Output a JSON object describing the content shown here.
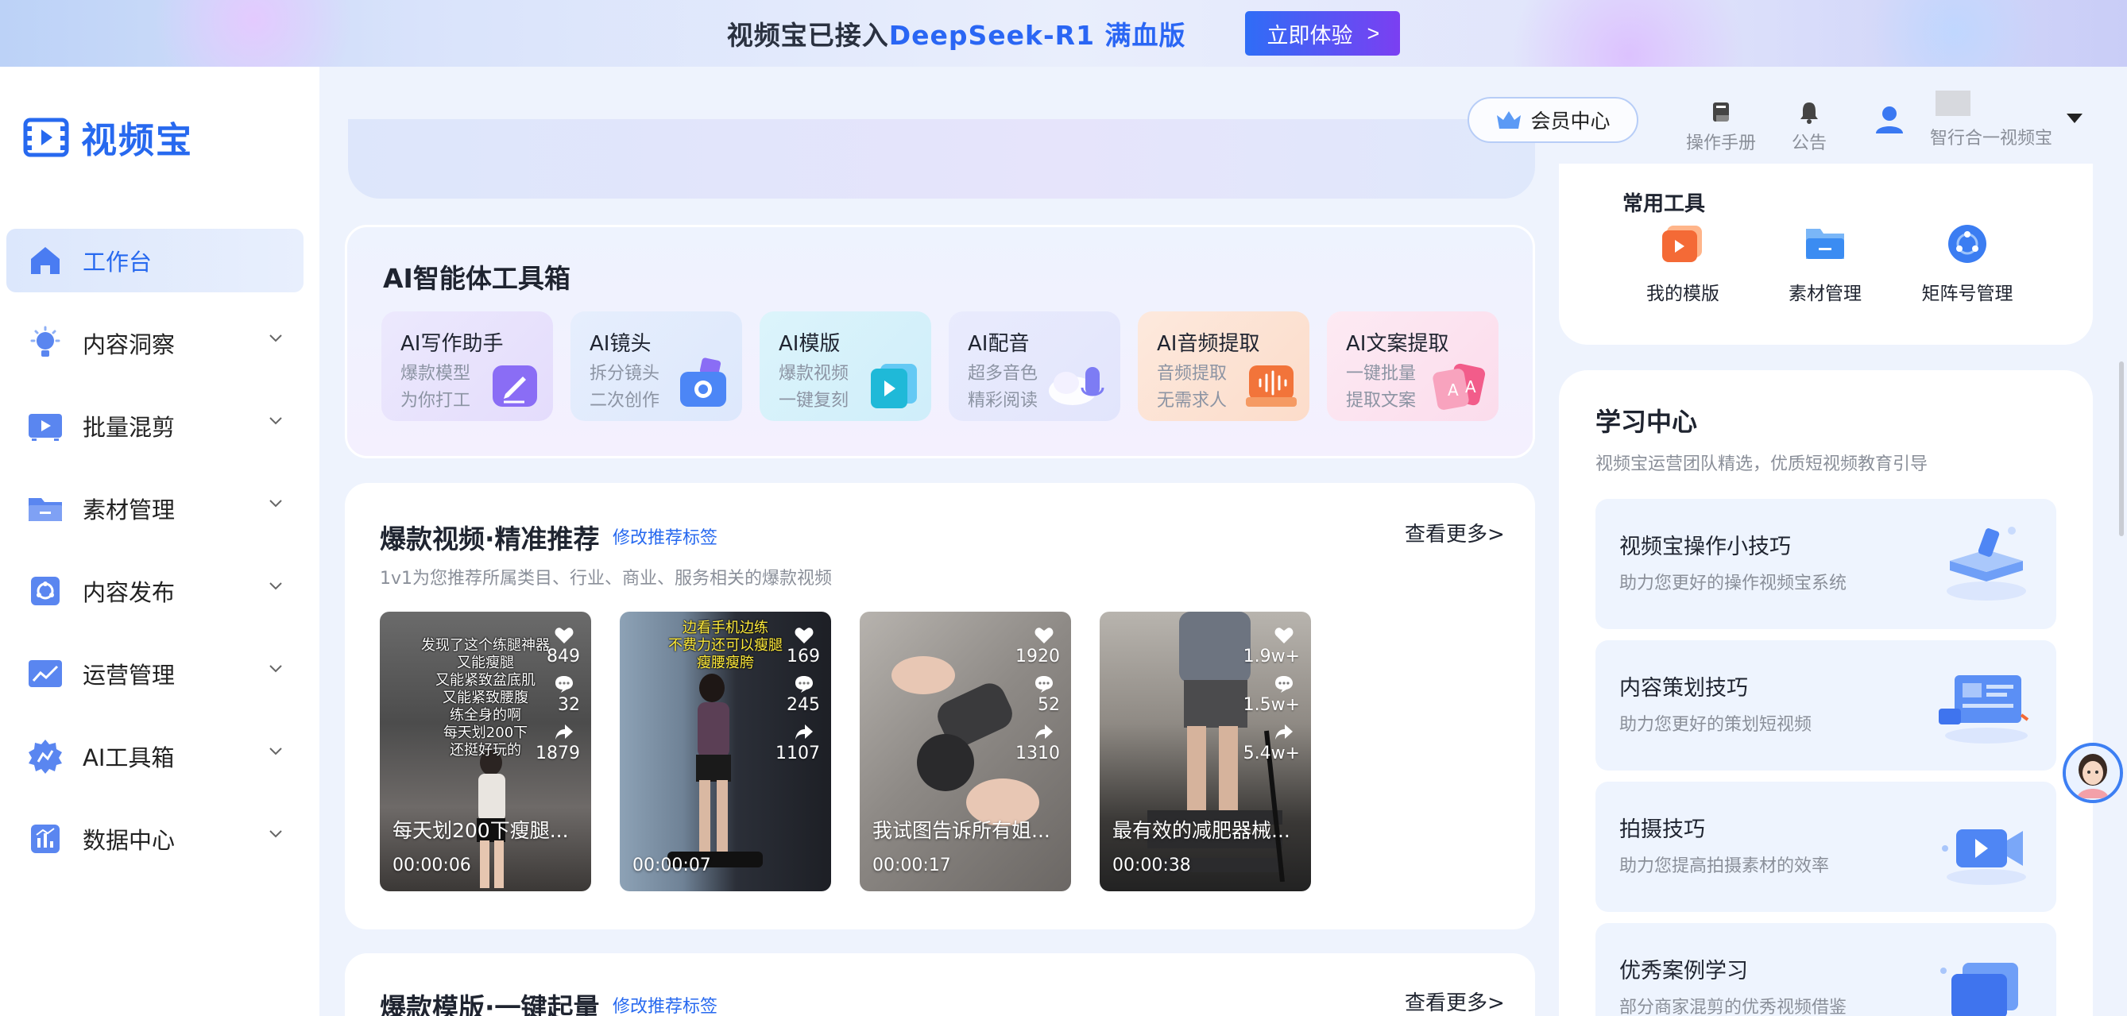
{
  "banner": {
    "text_prefix": "视频宝已接入",
    "text_highlight": "DeepSeek-R1 满血版",
    "cta_label": "立即体验",
    "cta_arrow": ">"
  },
  "app": {
    "logo_text": "视频宝"
  },
  "sidebar": {
    "items": [
      {
        "label": "工作台",
        "icon": "home-icon",
        "active": true
      },
      {
        "label": "内容洞察",
        "icon": "lightbulb-icon"
      },
      {
        "label": "批量混剪",
        "icon": "video-screen-icon"
      },
      {
        "label": "素材管理",
        "icon": "folder-icon"
      },
      {
        "label": "内容发布",
        "icon": "publish-icon"
      },
      {
        "label": "运营管理",
        "icon": "chart-line-icon"
      },
      {
        "label": "AI工具箱",
        "icon": "ai-gear-icon"
      },
      {
        "label": "数据中心",
        "icon": "bar-chart-icon"
      }
    ]
  },
  "header": {
    "member_label": "会员中心",
    "manual_label": "操作手册",
    "notice_label": "公告",
    "user_name": "智行合一视频宝"
  },
  "toolbox": {
    "title": "AI智能体工具箱",
    "tiles": [
      {
        "title": "AI写作助手",
        "sub1": "爆款模型",
        "sub2": "为你打工",
        "icon": "pen-icon",
        "color": "#8a6df5"
      },
      {
        "title": "AI镜头",
        "sub1": "拆分镜头",
        "sub2": "二次创作",
        "icon": "camera-icon",
        "color": "#4c86f6"
      },
      {
        "title": "AI模版",
        "sub1": "爆款视频",
        "sub2": "一键复刻",
        "icon": "play-template-icon",
        "color": "#1fb9d8"
      },
      {
        "title": "AI配音",
        "sub1": "超多音色",
        "sub2": "精彩阅读",
        "icon": "microphone-icon",
        "color": "#7d7cf4"
      },
      {
        "title": "AI音频提取",
        "sub1": "音频提取",
        "sub2": "无需求人",
        "icon": "audio-extract-icon",
        "color": "#f2743a"
      },
      {
        "title": "AI文案提取",
        "sub1": "一键批量",
        "sub2": "提取文案",
        "icon": "text-extract-icon",
        "color": "#f25c8a"
      }
    ]
  },
  "hot_videos": {
    "title": "爆款视频·精准推荐",
    "edit_tags": "修改推荐标签",
    "more": "查看更多>",
    "subtitle": "1v1为您推荐所属类目、行业、商业、服务相关的爆款视频",
    "videos": [
      {
        "title": "每天划200下瘦腿...",
        "duration": "00:00:06",
        "likes": "849",
        "comments": "32",
        "shares": "1879",
        "caption": [
          "发现了这个练腿神器",
          "又能瘦腿",
          "又能紧致盆底肌",
          "又能紧致腰腹",
          "练全身的啊",
          "每天划200下",
          "还挺好玩的"
        ]
      },
      {
        "title": "",
        "duration": "00:00:07",
        "likes": "169",
        "comments": "245",
        "shares": "1107",
        "caption": [
          "边看手机边练",
          "不费力还可以瘦腿",
          "瘦腰瘦胯"
        ]
      },
      {
        "title": "我试图告诉所有姐...",
        "duration": "00:00:17",
        "likes": "1920",
        "comments": "52",
        "shares": "1310",
        "caption": []
      },
      {
        "title": "最有效的减肥器械...",
        "duration": "00:00:38",
        "likes": "1.9w+",
        "comments": "1.5w+",
        "shares": "5.4w+",
        "caption": []
      }
    ]
  },
  "hot_templates": {
    "title": "爆款模版·一键起量",
    "edit_tags": "修改推荐标签",
    "more": "查看更多>"
  },
  "common_tools": {
    "title": "常用工具",
    "items": [
      {
        "label": "我的模版",
        "icon": "my-template-icon"
      },
      {
        "label": "素材管理",
        "icon": "material-folder-icon"
      },
      {
        "label": "矩阵号管理",
        "icon": "matrix-account-icon"
      }
    ]
  },
  "learning": {
    "title": "学习中心",
    "subtitle": "视频宝运营团队精选，优质短视频教育引导",
    "items": [
      {
        "title": "视频宝操作小技巧",
        "sub": "助力您更好的操作视频宝系统",
        "icon": "book-illustration-icon"
      },
      {
        "title": "内容策划技巧",
        "sub": "助力您更好的策划短视频",
        "icon": "document-illustration-icon"
      },
      {
        "title": "拍摄技巧",
        "sub": "助力您提高拍摄素材的效率",
        "icon": "video-camera-illustration-icon"
      },
      {
        "title": "优秀案例学习",
        "sub": "部分商家混剪的优秀视频借鉴",
        "icon": "case-illustration-icon"
      }
    ]
  }
}
